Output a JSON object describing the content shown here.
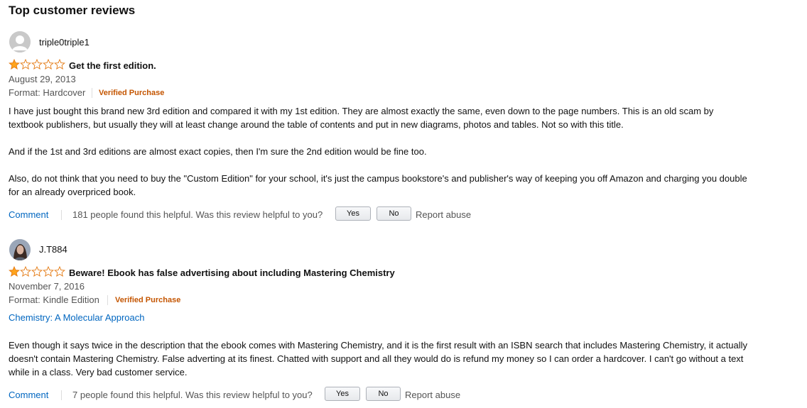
{
  "section_title": "Top customer reviews",
  "colors": {
    "link": "#0066c0",
    "verified": "#c45500",
    "star_fill": "#ffa41c",
    "star_outline": "#e47911",
    "muted_text": "#555555"
  },
  "reviews": [
    {
      "username": "triple0triple1",
      "avatar_icon": "default-user-avatar-icon",
      "rating": 1,
      "rating_max": 5,
      "title": "Get the first edition.",
      "date": "August 29, 2013",
      "format": "Format: Hardcover",
      "verified": "Verified Purchase",
      "product_link": "",
      "paragraphs": [
        "I have just bought this brand new 3rd edition and compared it with my 1st edition. They are almost exactly the same, even down to the page numbers. This is an old scam by textbook publishers, but usually they will at least change around the table of contents and put in new diagrams, photos and tables. Not so with this title.",
        "And if the 1st and 3rd editions are almost exact copies, then I'm sure the 2nd edition would be fine too.",
        "Also, do not think that you need to buy the \"Custom Edition\" for your school, it's just the campus bookstore's and publisher's way of keeping you off Amazon and charging you double for an already overpriced book."
      ],
      "comment_label": "Comment",
      "helpful_text": "181 people found this helpful. Was this review helpful to you?",
      "yes_label": "Yes",
      "no_label": "No",
      "report_label": "Report abuse"
    },
    {
      "username": "J.T884",
      "avatar_icon": "user-photo-avatar-icon",
      "rating": 1,
      "rating_max": 5,
      "title": "Beware! Ebook has false advertising about including Mastering Chemistry",
      "date": "November 7, 2016",
      "format": "Format: Kindle Edition",
      "verified": "Verified Purchase",
      "product_link": "Chemistry: A Molecular Approach",
      "paragraphs": [
        "Even though it says twice in the description that the ebook comes with Mastering Chemistry, and it is the first result with an ISBN search that includes Mastering Chemistry, it actually doesn't contain Mastering Chemistry. False adverting at its finest. Chatted with support and all they would do is refund my money so I can order a hardcover. I can't go without a text while in a class. Very bad customer service."
      ],
      "comment_label": "Comment",
      "helpful_text": "7 people found this helpful. Was this review helpful to you?",
      "yes_label": "Yes",
      "no_label": "No",
      "report_label": "Report abuse"
    }
  ]
}
